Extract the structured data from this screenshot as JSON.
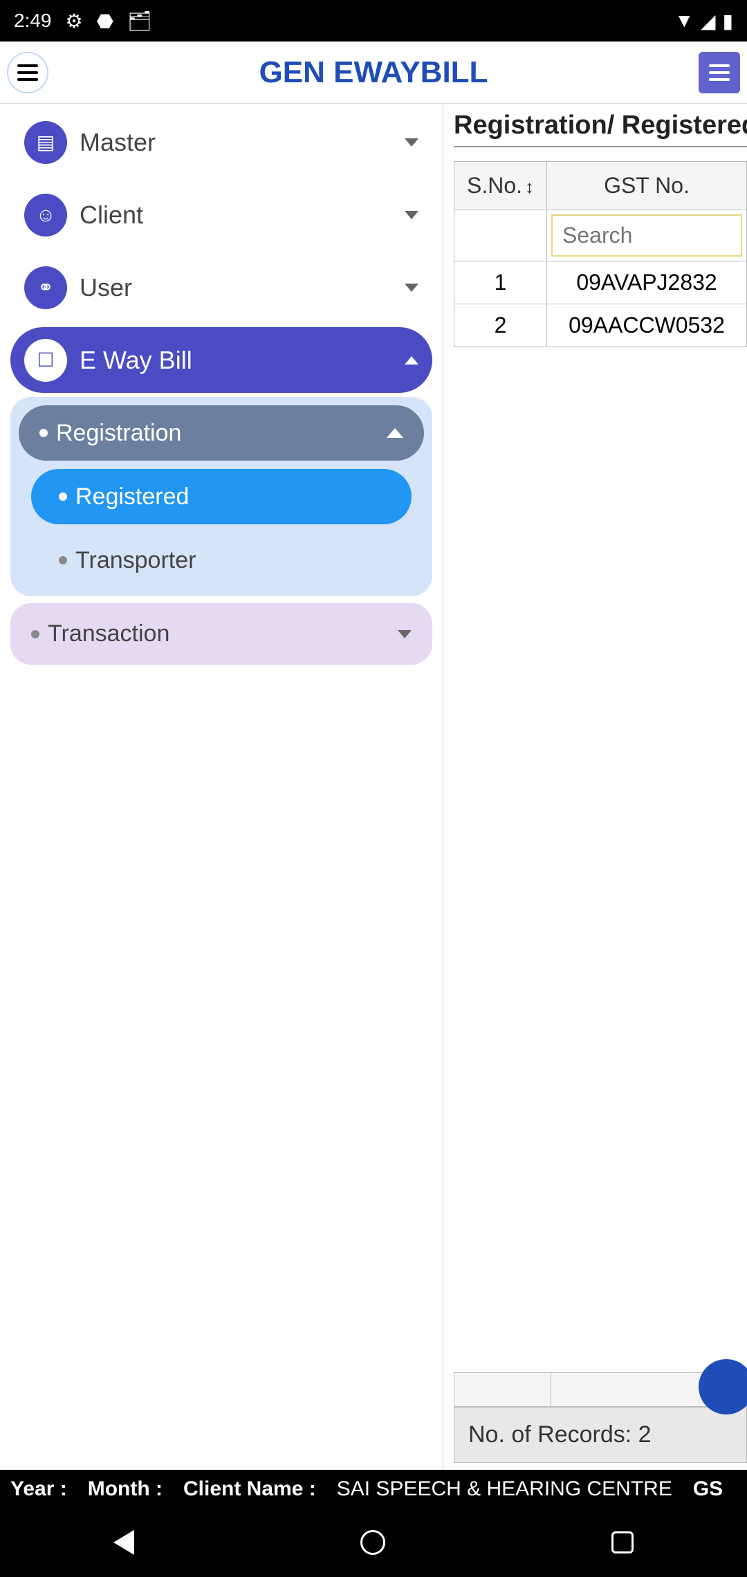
{
  "statusBar": {
    "time": "2:49"
  },
  "header": {
    "title": "GEN EWAYBILL"
  },
  "sidebar": {
    "items": [
      {
        "label": "Master"
      },
      {
        "label": "Client"
      },
      {
        "label": "User"
      },
      {
        "label": "E Way Bill"
      }
    ],
    "submenu": {
      "header": "Registration",
      "items": [
        {
          "label": "Registered"
        },
        {
          "label": "Transporter"
        }
      ]
    },
    "submenu2": {
      "label": "Transaction"
    }
  },
  "content": {
    "title": "Registration/ Registered",
    "columns": {
      "sno": "S.No.",
      "gstno": "GST No."
    },
    "searchPlaceholder": "Search",
    "rows": [
      {
        "sno": "1",
        "gstno": "09AVAPJ2832"
      },
      {
        "sno": "2",
        "gstno": "09AACCW0532"
      }
    ],
    "recordsLabel": "No. of Records: 2"
  },
  "infoBar": {
    "yearLabel": "Year :",
    "monthLabel": "Month :",
    "clientLabel": "Client Name :",
    "clientValue": "SAI SPEECH & HEARING CENTRE",
    "gstLabel": "GS"
  }
}
